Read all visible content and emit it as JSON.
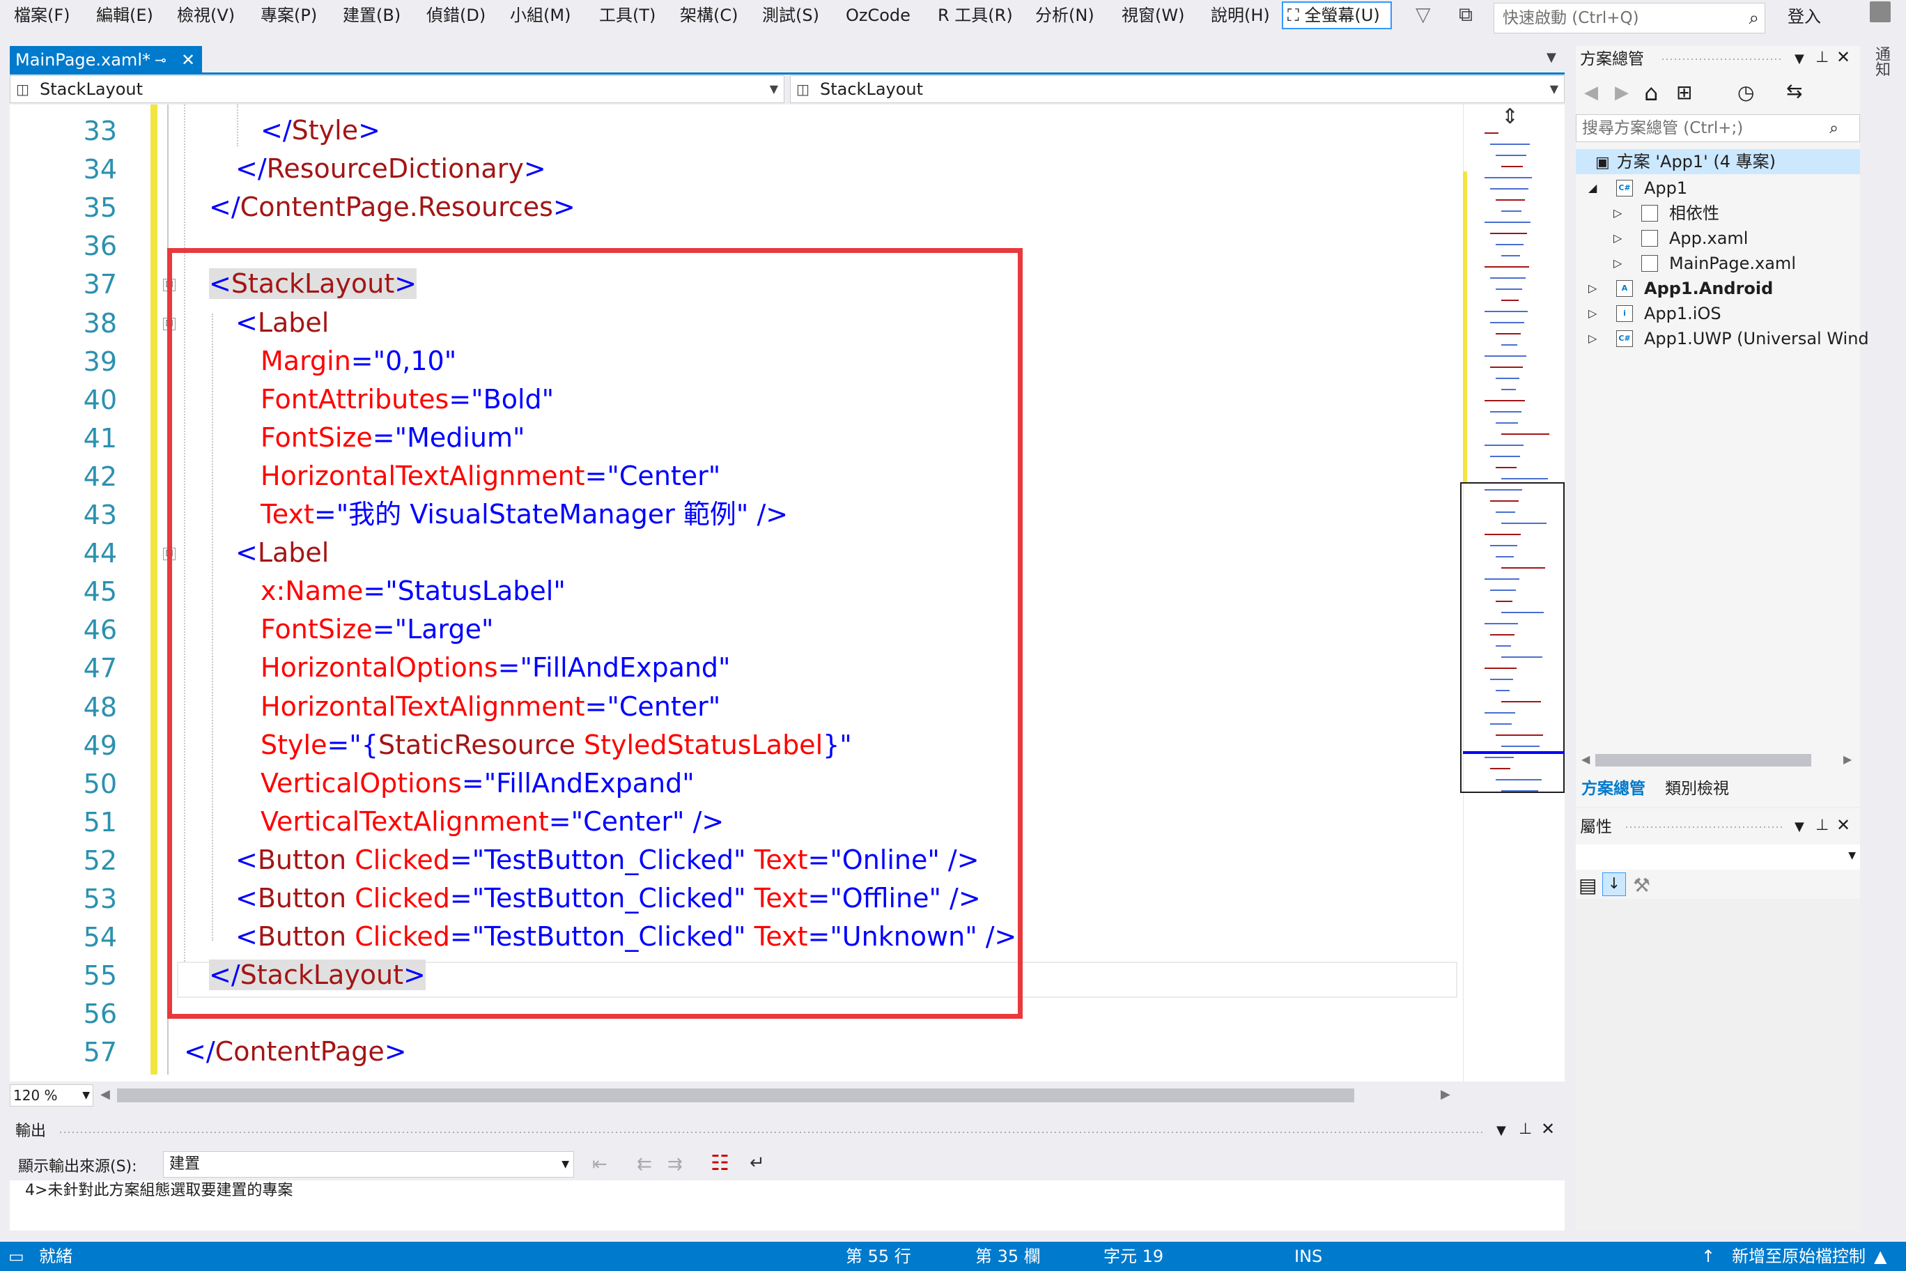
{
  "menu": [
    "檔案(F)",
    "編輯(E)",
    "檢視(V)",
    "專案(P)",
    "建置(B)",
    "偵錯(D)",
    "小組(M)",
    "工具(T)",
    "架構(C)",
    "測試(S)",
    "OzCode",
    "R 工具(R)",
    "分析(N)",
    "視窗(W)",
    "說明(H)"
  ],
  "fullscreen_label": "全螢幕(U)",
  "quick_launch_placeholder": "快速啟動 (Ctrl+Q)",
  "signin_label": "登入",
  "doc_tab": {
    "title": "MainPage.xaml*"
  },
  "nav": {
    "left": "StackLayout",
    "right": "StackLayout"
  },
  "editor": {
    "zoom": "120 %",
    "lines": [
      {
        "n": "33",
        "indent": 2,
        "parts": [
          [
            "</",
            "t-blue"
          ],
          [
            "Style",
            "t-maroon"
          ],
          [
            ">",
            "t-blue"
          ]
        ]
      },
      {
        "n": "34",
        "indent": 1,
        "parts": [
          [
            "</",
            "t-blue"
          ],
          [
            "ResourceDictionary",
            "t-maroon"
          ],
          [
            ">",
            "t-blue"
          ]
        ]
      },
      {
        "n": "35",
        "indent": 0,
        "parts": [
          [
            "</",
            "t-blue"
          ],
          [
            "ContentPage.Resources",
            "t-maroon"
          ],
          [
            ">",
            "t-blue"
          ]
        ]
      },
      {
        "n": "36",
        "indent": 0,
        "parts": []
      },
      {
        "n": "37",
        "indent": 0,
        "parts": [
          [
            "<",
            "t-blue hl-tag"
          ],
          [
            "StackLayout",
            "t-maroon hl-tag"
          ],
          [
            ">",
            "t-blue hl-tag"
          ]
        ]
      },
      {
        "n": "38",
        "indent": 1,
        "parts": [
          [
            "<",
            "t-blue"
          ],
          [
            "Label",
            "t-maroon"
          ]
        ]
      },
      {
        "n": "39",
        "indent": 2,
        "parts": [
          [
            "Margin",
            "t-red"
          ],
          [
            "=",
            "t-blue"
          ],
          [
            "\"0,10\"",
            "t-blue"
          ]
        ]
      },
      {
        "n": "40",
        "indent": 2,
        "parts": [
          [
            "FontAttributes",
            "t-red"
          ],
          [
            "=",
            "t-blue"
          ],
          [
            "\"Bold\"",
            "t-blue"
          ]
        ]
      },
      {
        "n": "41",
        "indent": 2,
        "parts": [
          [
            "FontSize",
            "t-red"
          ],
          [
            "=",
            "t-blue"
          ],
          [
            "\"Medium\"",
            "t-blue"
          ]
        ]
      },
      {
        "n": "42",
        "indent": 2,
        "parts": [
          [
            "HorizontalTextAlignment",
            "t-red"
          ],
          [
            "=",
            "t-blue"
          ],
          [
            "\"Center\"",
            "t-blue"
          ]
        ]
      },
      {
        "n": "43",
        "indent": 2,
        "parts": [
          [
            "Text",
            "t-red"
          ],
          [
            "=",
            "t-blue"
          ],
          [
            "\"我的 VisualStateManager 範例\"",
            "t-blue"
          ],
          [
            " />",
            "t-blue"
          ]
        ]
      },
      {
        "n": "44",
        "indent": 1,
        "parts": [
          [
            "<",
            "t-blue"
          ],
          [
            "Label",
            "t-maroon"
          ]
        ]
      },
      {
        "n": "45",
        "indent": 2,
        "parts": [
          [
            "x:Name",
            "t-red"
          ],
          [
            "=",
            "t-blue"
          ],
          [
            "\"StatusLabel\"",
            "t-blue"
          ]
        ]
      },
      {
        "n": "46",
        "indent": 2,
        "parts": [
          [
            "FontSize",
            "t-red"
          ],
          [
            "=",
            "t-blue"
          ],
          [
            "\"Large\"",
            "t-blue"
          ]
        ]
      },
      {
        "n": "47",
        "indent": 2,
        "parts": [
          [
            "HorizontalOptions",
            "t-red"
          ],
          [
            "=",
            "t-blue"
          ],
          [
            "\"FillAndExpand\"",
            "t-blue"
          ]
        ]
      },
      {
        "n": "48",
        "indent": 2,
        "parts": [
          [
            "HorizontalTextAlignment",
            "t-red"
          ],
          [
            "=",
            "t-blue"
          ],
          [
            "\"Center\"",
            "t-blue"
          ]
        ]
      },
      {
        "n": "49",
        "indent": 2,
        "parts": [
          [
            "Style",
            "t-red"
          ],
          [
            "=",
            "t-blue"
          ],
          [
            "\"{",
            "t-blue"
          ],
          [
            "StaticResource",
            "t-maroon"
          ],
          [
            " StyledStatusLabel",
            "t-red"
          ],
          [
            "}\"",
            "t-blue"
          ]
        ]
      },
      {
        "n": "50",
        "indent": 2,
        "parts": [
          [
            "VerticalOptions",
            "t-red"
          ],
          [
            "=",
            "t-blue"
          ],
          [
            "\"FillAndExpand\"",
            "t-blue"
          ]
        ]
      },
      {
        "n": "51",
        "indent": 2,
        "parts": [
          [
            "VerticalTextAlignment",
            "t-red"
          ],
          [
            "=",
            "t-blue"
          ],
          [
            "\"Center\"",
            "t-blue"
          ],
          [
            " />",
            "t-blue"
          ]
        ]
      },
      {
        "n": "52",
        "indent": 1,
        "parts": [
          [
            "<",
            "t-blue"
          ],
          [
            "Button",
            "t-maroon"
          ],
          [
            " Clicked",
            "t-red"
          ],
          [
            "=",
            "t-blue"
          ],
          [
            "\"TestButton_Clicked\"",
            "t-blue"
          ],
          [
            " Text",
            "t-red"
          ],
          [
            "=",
            "t-blue"
          ],
          [
            "\"Online\"",
            "t-blue"
          ],
          [
            " />",
            "t-blue"
          ]
        ]
      },
      {
        "n": "53",
        "indent": 1,
        "parts": [
          [
            "<",
            "t-blue"
          ],
          [
            "Button",
            "t-maroon"
          ],
          [
            " Clicked",
            "t-red"
          ],
          [
            "=",
            "t-blue"
          ],
          [
            "\"TestButton_Clicked\"",
            "t-blue"
          ],
          [
            " Text",
            "t-red"
          ],
          [
            "=",
            "t-blue"
          ],
          [
            "\"Offline\"",
            "t-blue"
          ],
          [
            " />",
            "t-blue"
          ]
        ]
      },
      {
        "n": "54",
        "indent": 1,
        "parts": [
          [
            "<",
            "t-blue"
          ],
          [
            "Button",
            "t-maroon"
          ],
          [
            " Clicked",
            "t-red"
          ],
          [
            "=",
            "t-blue"
          ],
          [
            "\"TestButton_Clicked\"",
            "t-blue"
          ],
          [
            " Text",
            "t-red"
          ],
          [
            "=",
            "t-blue"
          ],
          [
            "\"Unknown\"",
            "t-blue"
          ],
          [
            " />",
            "t-blue"
          ]
        ]
      },
      {
        "n": "55",
        "indent": 0,
        "parts": [
          [
            "</",
            "t-blue hl-tag"
          ],
          [
            "StackLayout",
            "t-maroon hl-tag"
          ],
          [
            ">",
            "t-blue hl-tag"
          ]
        ]
      },
      {
        "n": "56",
        "indent": 0,
        "parts": []
      },
      {
        "n": "57",
        "indent": -1,
        "parts": [
          [
            "</",
            "t-blue"
          ],
          [
            "ContentPage",
            "t-maroon"
          ],
          [
            ">",
            "t-blue"
          ]
        ]
      }
    ]
  },
  "output": {
    "title": "輸出",
    "source_label": "顯示輸出來源(S):",
    "source_value": "建置",
    "text": "4>未針對此方案組態選取要建置的專案"
  },
  "status": {
    "ready": "就緒",
    "line": "第 55 行",
    "col": "第 35 欄",
    "char": "字元 19",
    "mode": "INS",
    "source_control": "新增至原始檔控制"
  },
  "solution": {
    "title": "方案總管",
    "search_placeholder": "搜尋方案總管 (Ctrl+;)",
    "root": "方案 'App1' (4 專案)",
    "items": [
      {
        "label": "App1",
        "level": 1,
        "icon": "C#",
        "arrow": "◢",
        "bold": false
      },
      {
        "label": "相依性",
        "level": 2,
        "icon": "",
        "arrow": "▷",
        "bold": false
      },
      {
        "label": "App.xaml",
        "level": 2,
        "icon": "",
        "arrow": "▷",
        "bold": false
      },
      {
        "label": "MainPage.xaml",
        "level": 2,
        "icon": "",
        "arrow": "▷",
        "bold": false
      },
      {
        "label": "App1.Android",
        "level": 1,
        "icon": "A",
        "arrow": "▷",
        "bold": true
      },
      {
        "label": "App1.iOS",
        "level": 1,
        "icon": "i",
        "arrow": "▷",
        "bold": false
      },
      {
        "label": "App1.UWP (Universal Wind",
        "level": 1,
        "icon": "C#",
        "arrow": "▷",
        "bold": false
      }
    ],
    "tab_solution": "方案總管",
    "tab_class": "類別檢視"
  },
  "properties": {
    "title": "屬性"
  },
  "notifications": "通知",
  "colors": {
    "accent": "#007acc",
    "highlight_box": "#e8393c",
    "change_bar": "#f1e541"
  }
}
